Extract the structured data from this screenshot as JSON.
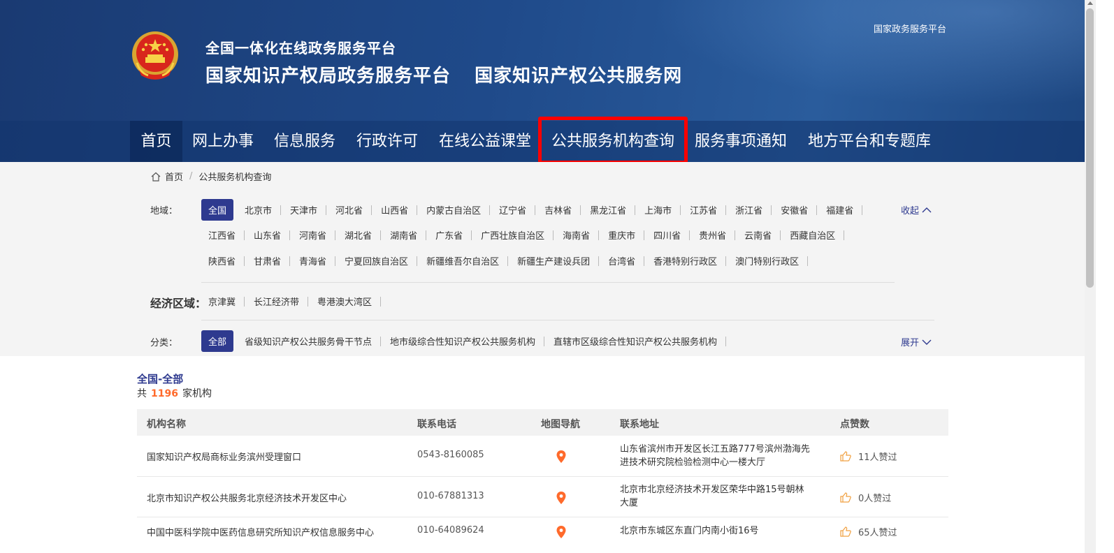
{
  "header": {
    "platform_line": "全国一体化在线政务服务平台",
    "title_left": "国家知识产权局政务服务平台",
    "title_right": "国家知识产权公共服务网",
    "top_link": "国家政务服务平台",
    "emblem_icon": "national-emblem-icon"
  },
  "nav": {
    "items": [
      "首页",
      "网上办事",
      "信息服务",
      "行政许可",
      "在线公益课堂",
      "公共服务机构查询",
      "服务事项通知",
      "地方平台和专题库"
    ],
    "active_index": 0,
    "highlight_index": 5,
    "highlight_color": "#ff0000"
  },
  "breadcrumb": {
    "home": "首页",
    "separator": "/",
    "current": "公共服务机构查询"
  },
  "filters": {
    "region_label": "地域：",
    "region_row1": [
      "全国",
      "北京市",
      "天津市",
      "河北省",
      "山西省",
      "内蒙古自治区",
      "辽宁省",
      "吉林省",
      "黑龙江省",
      "上海市",
      "江苏省",
      "浙江省",
      "安徽省",
      "福建省"
    ],
    "region_row2": [
      "江西省",
      "山东省",
      "河南省",
      "湖北省",
      "湖南省",
      "广东省",
      "广西壮族自治区",
      "海南省",
      "重庆市",
      "四川省",
      "贵州省",
      "云南省",
      "西藏自治区"
    ],
    "region_row3": [
      "陕西省",
      "甘肃省",
      "青海省",
      "宁夏回族自治区",
      "新疆维吾尔自治区",
      "新疆生产建设兵团",
      "台湾省",
      "香港特别行政区",
      "澳门特别行政区"
    ],
    "collapse_label": "收起",
    "economic_label": "经济区域：",
    "economic_items": [
      "京津冀",
      "长江经济带",
      "粤港澳大湾区"
    ],
    "category_label": "分类：",
    "category_items": [
      "全部",
      "省级知识产权公共服务骨干节点",
      "地市级综合性知识产权公共服务机构",
      "直辖市区级综合性知识产权公共服务机构"
    ],
    "expand_label": "展开",
    "accent_color": "#2e3a8f"
  },
  "results": {
    "title": "全国-全部",
    "count_prefix": "共",
    "count": "1196",
    "count_suffix": "家机构",
    "count_color": "#ff6a2b",
    "columns": [
      "机构名称",
      "联系电话",
      "地图导航",
      "联系地址",
      "点赞数"
    ],
    "rows": [
      {
        "name": "国家知识产权局商标业务滨州受理窗口",
        "phone": "0543-8160085",
        "addr1": "山东省滨州市开发区长江五路777号滨州渤海先",
        "addr2": "进技术研究院检验检测中心一楼大厅",
        "likes": "11人赞过"
      },
      {
        "name": "北京市知识产权公共服务北京经济技术开发区中心",
        "phone": "010-67881313",
        "addr1": "北京市北京经济技术开发区荣华中路15号朝林",
        "addr2": "大厦",
        "likes": "0人赞过"
      },
      {
        "name": "中国中医科学院中医药信息研究所知识产权信息服务中心",
        "phone": "010-64089624",
        "addr1": "北京市东城区东直门内南小街16号",
        "addr2": "",
        "likes": "65人赞过"
      }
    ],
    "pin_color": "#ff6a2b",
    "like_icon_color": "#f0a040"
  }
}
